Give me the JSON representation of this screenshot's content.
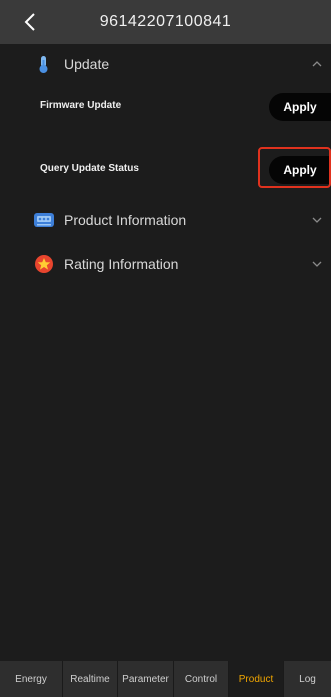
{
  "header": {
    "title": "96142207100841",
    "back_icon": "chevron-left-icon"
  },
  "sections": {
    "update": {
      "label": "Update",
      "icon": "thermometer-icon",
      "expanded": true
    },
    "product": {
      "label": "Product Information",
      "icon": "device-icon",
      "expanded": false
    },
    "rating": {
      "label": "Rating Information",
      "icon": "star-badge-icon",
      "expanded": false
    }
  },
  "rows": {
    "firmware": {
      "label": "Firmware Update",
      "button": "Apply"
    },
    "query": {
      "label": "Query Update Status",
      "button": "Apply"
    }
  },
  "tabs": [
    {
      "label": "Energy"
    },
    {
      "label": "Realtime"
    },
    {
      "label": "Parameter"
    },
    {
      "label": "Control"
    },
    {
      "label": "Product",
      "active": true
    },
    {
      "label": "Log"
    }
  ],
  "colors": {
    "accent": "#f0a500",
    "highlight": "#e0321e",
    "background": "#1c1c1c",
    "header": "#3a3a3a"
  }
}
